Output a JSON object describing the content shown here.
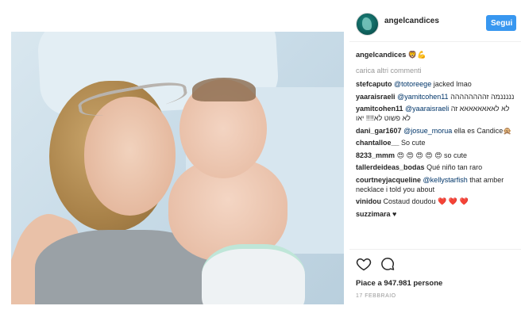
{
  "post": {
    "username": "angelcandices",
    "follow_label": "Segui",
    "caption_user": "angelcandices",
    "caption_emoji": "🦁💪",
    "load_more": "carica altri commenti",
    "likes": "Piace a 947.981 persone",
    "date": "17 FEBBRAIO"
  },
  "comments": [
    {
      "user": "stefcaputo",
      "mention": "@totoreege",
      "text": "jacked lmao"
    },
    {
      "user": "yaaraisraeli",
      "mention": "@yamitcohen11",
      "text": "מה זהההההההה‎נננננ"
    },
    {
      "user": "yamitcohen11",
      "mention": "@yaaraisraeli",
      "text": "לא לאאאאאאאא זה לא פשוט לא!!!! יאו"
    },
    {
      "user": "dani_gar1607",
      "mention": "@josue_morua",
      "text": "ella es Candice🙊"
    },
    {
      "user": "chantalloe__",
      "mention": "",
      "text": "So cute"
    },
    {
      "user": "8233_mmm",
      "mention": "",
      "text": "😍 😍 😍 😍 😍 so cute"
    },
    {
      "user": "tallerdeideas_bodas",
      "mention": "",
      "text": "Qué niño tan raro"
    },
    {
      "user": "courtneyjacqueline",
      "mention": "@kellystarfish",
      "text": "that amber necklace i told you about"
    },
    {
      "user": "vinidou",
      "mention": "",
      "text": "Costaud doudou ❤️ ❤️ ❤️"
    },
    {
      "user": "suzzimara",
      "mention": "",
      "text": "♥"
    }
  ],
  "icons": {
    "like": "heart-outline-icon",
    "comment": "comment-bubble-icon"
  },
  "colors": {
    "follow_button": "#3897f0",
    "mention": "#003569",
    "muted": "#999999"
  }
}
